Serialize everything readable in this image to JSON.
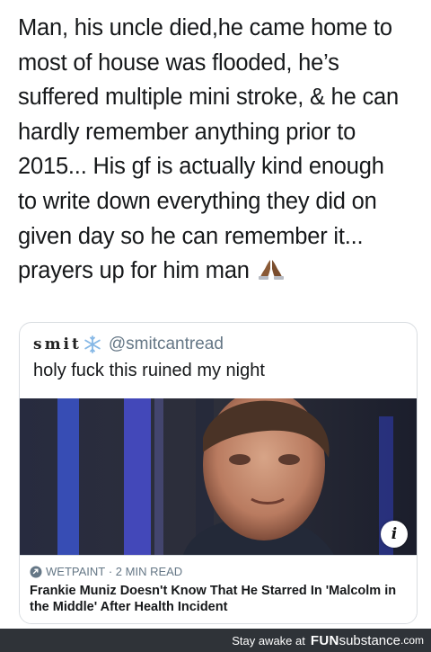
{
  "tweet": {
    "lines": [
      "Man, his uncle died,he came home to",
      "most of house was flooded, he’s",
      "suffered multiple mini stroke, & he can",
      "hardly remember anything prior to",
      "2015... His gf is actually kind enough",
      "to write down everything they did on",
      "given day so he can remember it...",
      "prayers up for him man"
    ],
    "emoji": "folded-hands-icon"
  },
  "quote": {
    "name": "smit",
    "name_emoji": "snowflake-icon",
    "handle": "@smitcantread",
    "text": "holy fuck this ruined my night",
    "card": {
      "source": "WETPAINT",
      "separator": "·",
      "read_time": "2 MIN READ",
      "headline": "Frankie Muniz Doesn't Know That He Starred In 'Malcolm in the Middle' After Health Incident",
      "info_label": "i"
    }
  },
  "footer": {
    "caption": "Stay awake at",
    "brand_bold": "FUN",
    "brand_regular": "substance",
    "brand_suffix": ".com"
  },
  "colors": {
    "text": "#16181a",
    "secondary": "#657786",
    "border": "#d9dde1",
    "footer_bg": "#2f3338"
  }
}
